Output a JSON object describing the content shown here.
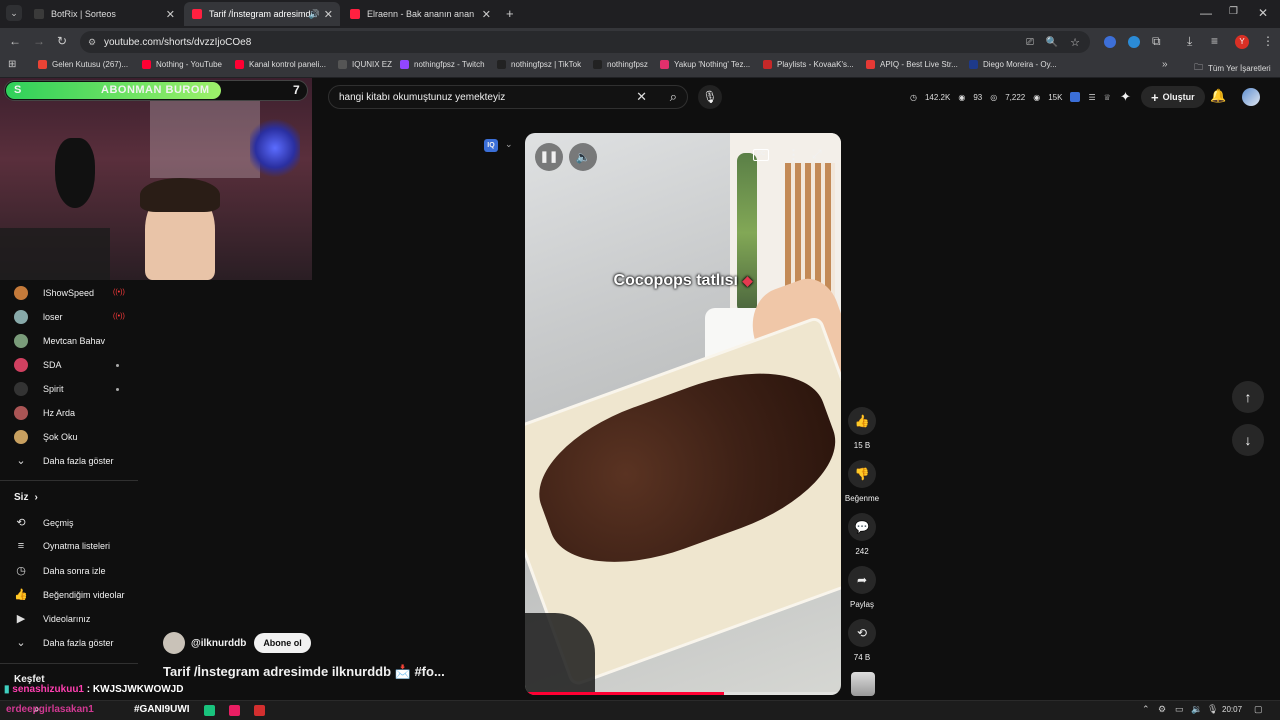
{
  "tabs": [
    {
      "title": "BotRix | Sorteos",
      "color": "#2b2b2b"
    },
    {
      "title": "Tarif /İnstegram adresimde",
      "color": "#ff2040"
    },
    {
      "title": "Elraenn - Bak ananın anan ANA",
      "color": "#ff2040"
    }
  ],
  "url": "youtube.com/shorts/dvzzIjoCOe8",
  "bookmarks": [
    {
      "label": "Gelen Kutusu (267)...",
      "color": "#ea4335"
    },
    {
      "label": "Nothing - YouTube",
      "color": "#ff0033"
    },
    {
      "label": "Kanal kontrol paneli...",
      "color": "#ff0033"
    },
    {
      "label": "IQUNIX EZ",
      "color": "#555555"
    },
    {
      "label": "nothingfpsz - Twitch",
      "color": "#9146ff"
    },
    {
      "label": "nothingfpsz | TikTok",
      "color": "#222222"
    },
    {
      "label": "nothingfpsz",
      "color": "#222222"
    },
    {
      "label": "Yakup 'Nothing' Tez...",
      "color": "#e1306c"
    },
    {
      "label": "Playlists - KovaaK's...",
      "color": "#c62828"
    },
    {
      "label": "APIQ - Best Live Str...",
      "color": "#e53935"
    },
    {
      "label": "Diego Moreira - Oy...",
      "color": "#1e3a8a"
    }
  ],
  "all_bookmarks": "Tüm Yer İşaretleri",
  "overlay": {
    "prefix": "S",
    "banner": "ABONMAN BUROM",
    "count": "7",
    "stats": "142.2K",
    "stat2": "93",
    "stat3": "7,222",
    "stat4": "15K"
  },
  "search": {
    "query": "hangi kitabı okumuştunuz yemekteyiz"
  },
  "create_label": "Oluştur",
  "subscriptions": [
    {
      "name": "IShowSpeed",
      "live": true,
      "color": "#c47a3a"
    },
    {
      "name": "loser",
      "live": true,
      "color": "#8aa"
    },
    {
      "name": "Mevtcan Bahav",
      "live": false,
      "color": "#7a9c7a"
    },
    {
      "name": "SDA",
      "live": false,
      "dot": true,
      "color": "#d04060"
    },
    {
      "name": "Spirit",
      "live": false,
      "dot": true,
      "color": "#333"
    },
    {
      "name": "Hz Arda",
      "live": false,
      "color": "#a55"
    },
    {
      "name": "Şok Oku",
      "live": false,
      "color": "#c8a060"
    }
  ],
  "live_badge": "((•))",
  "show_more": "Daha fazla göster",
  "you_section": "Siz",
  "you_items": [
    "Geçmiş",
    "Oynatma listeleri",
    "Daha sonra izle",
    "Beğendiğim videolar",
    "Videolarınız",
    "Daha fazla göster"
  ],
  "explore": "Keşfet",
  "chat": {
    "user": "senashizukuu1",
    "message": ": KWJSJWKWOWJD",
    "user2": "erdeepgirlasakan1",
    "tag": "#GANI9UWI"
  },
  "video": {
    "caption": "Cocopops tatlısı",
    "progress": 0.63
  },
  "channel": {
    "handle": "@ilknurddb",
    "subscribe": "Abone ol"
  },
  "title": "Tarif /İnstegram adresimde   ilknurddb 📩 #fo...",
  "actions": [
    {
      "icon": "like-icon",
      "glyph": "👍",
      "label": "15 B"
    },
    {
      "icon": "dislike-icon",
      "glyph": "👎",
      "label": "Beğenme"
    },
    {
      "icon": "comment-icon",
      "glyph": "💬",
      "label": "242"
    },
    {
      "icon": "share-icon",
      "glyph": "➦",
      "label": "Paylaş"
    },
    {
      "icon": "remix-icon",
      "glyph": "⟲",
      "label": "74 B"
    }
  ],
  "clock": "20:07"
}
